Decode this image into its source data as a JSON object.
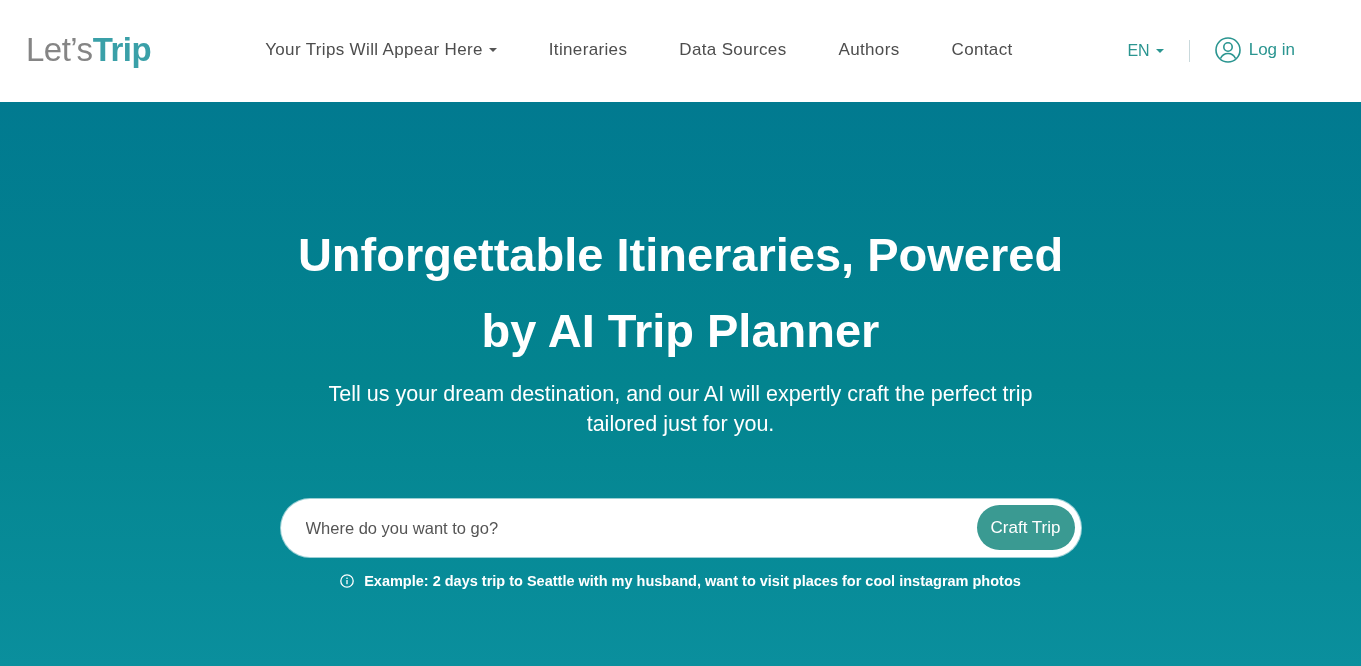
{
  "logo": {
    "lead": "Let’s",
    "accent": "Trip"
  },
  "nav": [
    {
      "label": "Your Trips Will Appear Here",
      "kind": "dropdown"
    },
    {
      "label": "Itineraries",
      "kind": "link"
    },
    {
      "label": "Data Sources",
      "kind": "link"
    },
    {
      "label": "Authors",
      "kind": "link"
    },
    {
      "label": "Contact",
      "kind": "link"
    }
  ],
  "language": {
    "label": "EN"
  },
  "login": {
    "label": "Log in"
  },
  "hero": {
    "title": "Unforgettable Itineraries, Powered by AI Trip Planner",
    "subtitle": "Tell us your dream destination, and our AI will expertly craft the perfect trip tailored just for you.",
    "search": {
      "placeholder": "Where do you want to go?",
      "button": "Craft Trip"
    },
    "hint": "Example: 2 days trip to Seattle with my husband, want to visit places for cool instagram photos"
  }
}
